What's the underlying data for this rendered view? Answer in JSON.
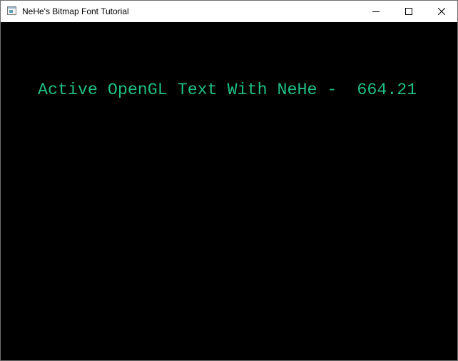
{
  "window": {
    "title": "NeHe's Bitmap Font Tutorial",
    "icon": "application-window-icon"
  },
  "caption_buttons": {
    "minimize_icon": "minimize-icon",
    "maximize_icon": "maximize-icon",
    "close_icon": "close-icon"
  },
  "scene": {
    "background": "#000000",
    "text_color": "#1fbf84",
    "text": "Active OpenGL Text With NeHe -  664.21"
  }
}
